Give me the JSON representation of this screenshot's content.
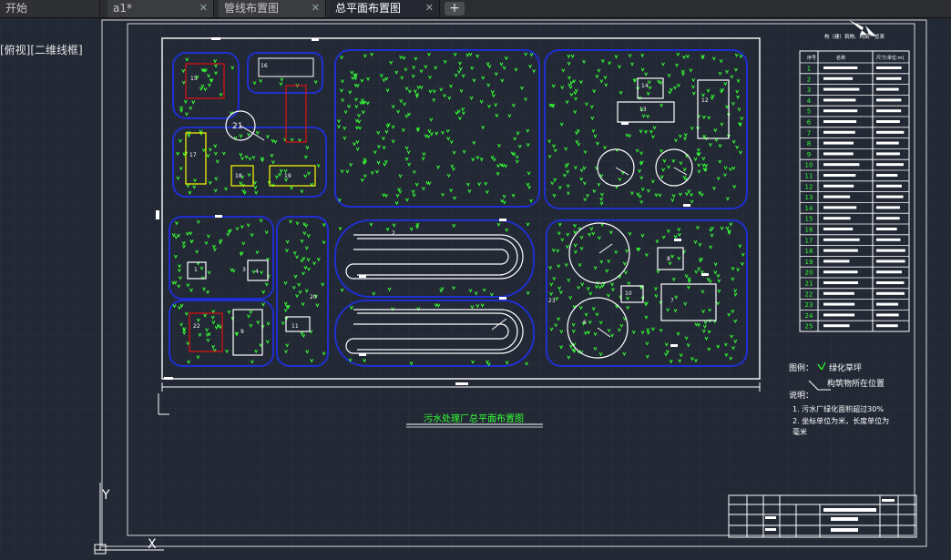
{
  "tabs": [
    {
      "label": "开始",
      "closable": false,
      "active": false
    },
    {
      "label": "a1*",
      "closable": true,
      "active": false
    },
    {
      "label": "管线布置图",
      "closable": true,
      "active": false
    },
    {
      "label": "总平面布置图",
      "closable": true,
      "active": true
    }
  ],
  "add_tab_symbol": "+",
  "viewport_label": "[俯视][二维线框]",
  "drawing": {
    "title": "污水处理厂总平面布置图",
    "legend_heading": "图例：",
    "legend_green_label": "绿化草坪",
    "legend_building_label": "构筑物所在位置",
    "notes_heading": "说明：",
    "notes": [
      "1. 污水厂绿化面积超过30%",
      "2. 坐标单位为米，长度单位为",
      "毫米"
    ],
    "table_header": "构（建）筑物、构筑一览表",
    "table_columns": [
      "序号",
      "名称",
      "尺寸(单位:m)"
    ],
    "table_row_numbers": [
      "1",
      "2",
      "3",
      "4",
      "5",
      "6",
      "7",
      "8",
      "9",
      "10",
      "11",
      "12",
      "13",
      "14",
      "15",
      "16",
      "17",
      "18",
      "19",
      "20",
      "21",
      "22",
      "23",
      "24",
      "25"
    ],
    "ucs_y": "Y",
    "ucs_x": "X",
    "building_numbers": [
      "15",
      "16",
      "21",
      "17",
      "18",
      "19",
      "20",
      "14",
      "13",
      "12",
      "1",
      "3",
      "8",
      "4",
      "2",
      "22",
      "23",
      "7",
      "10",
      "6",
      "9",
      "11"
    ]
  },
  "colors": {
    "background": "#222834",
    "grid": "#2b3140",
    "frame": "#ffffff",
    "zone_outline": "#1f2fd0",
    "tree": "#35ff35",
    "building_yellow": "#ffff00",
    "building_red": "#e01010",
    "title_green": "#35ff35"
  }
}
